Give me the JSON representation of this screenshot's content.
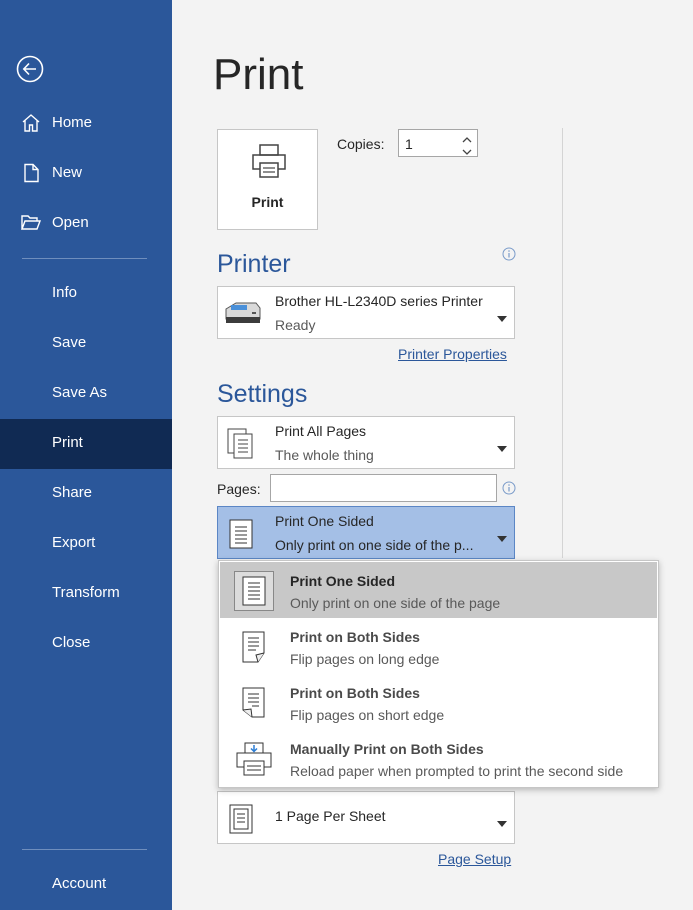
{
  "sidebar": {
    "items": [
      {
        "label": "Home",
        "icon": "home-icon"
      },
      {
        "label": "New",
        "icon": "new-document-icon"
      },
      {
        "label": "Open",
        "icon": "folder-open-icon"
      },
      {
        "label": "Info"
      },
      {
        "label": "Save"
      },
      {
        "label": "Save As"
      },
      {
        "label": "Print"
      },
      {
        "label": "Share"
      },
      {
        "label": "Export"
      },
      {
        "label": "Transform"
      },
      {
        "label": "Close"
      }
    ],
    "account_label": "Account",
    "active": "Print"
  },
  "main": {
    "title": "Print",
    "print_button_label": "Print",
    "copies_label": "Copies:",
    "copies_value": "1",
    "printer_section": "Printer",
    "printer_name": "Brother HL-L2340D series Printer",
    "printer_status": "Ready",
    "printer_properties_link": "Printer Properties",
    "settings_section": "Settings",
    "pages_setting": {
      "title": "Print All Pages",
      "subtitle": "The whole thing"
    },
    "pages_label": "Pages:",
    "pages_value": "",
    "sided_setting": {
      "title": "Print One Sided",
      "subtitle": "Only print on one side of the p..."
    },
    "sheet_setting": {
      "title": "1 Page Per Sheet"
    },
    "page_setup_link": "Page Setup"
  },
  "menu": {
    "options": [
      {
        "title": "Print One Sided",
        "subtitle": "Only print on one side of the page",
        "icon": "one-sided-page-icon",
        "highlighted": true
      },
      {
        "title": "Print on Both Sides",
        "subtitle": "Flip pages on long edge",
        "icon": "flip-long-edge-icon"
      },
      {
        "title": "Print on Both Sides",
        "subtitle": "Flip pages on short edge",
        "icon": "flip-short-edge-icon"
      },
      {
        "title": "Manually Print on Both Sides",
        "subtitle": "Reload paper when prompted to print the second side",
        "icon": "manual-duplex-printer-icon"
      }
    ]
  },
  "colors": {
    "sidebar_bg": "#2b579a",
    "sidebar_active": "#102a53",
    "accent": "#2b579a",
    "selected_dropdown": "#a4bfe6",
    "menu_highlight": "#c8c8c8"
  }
}
